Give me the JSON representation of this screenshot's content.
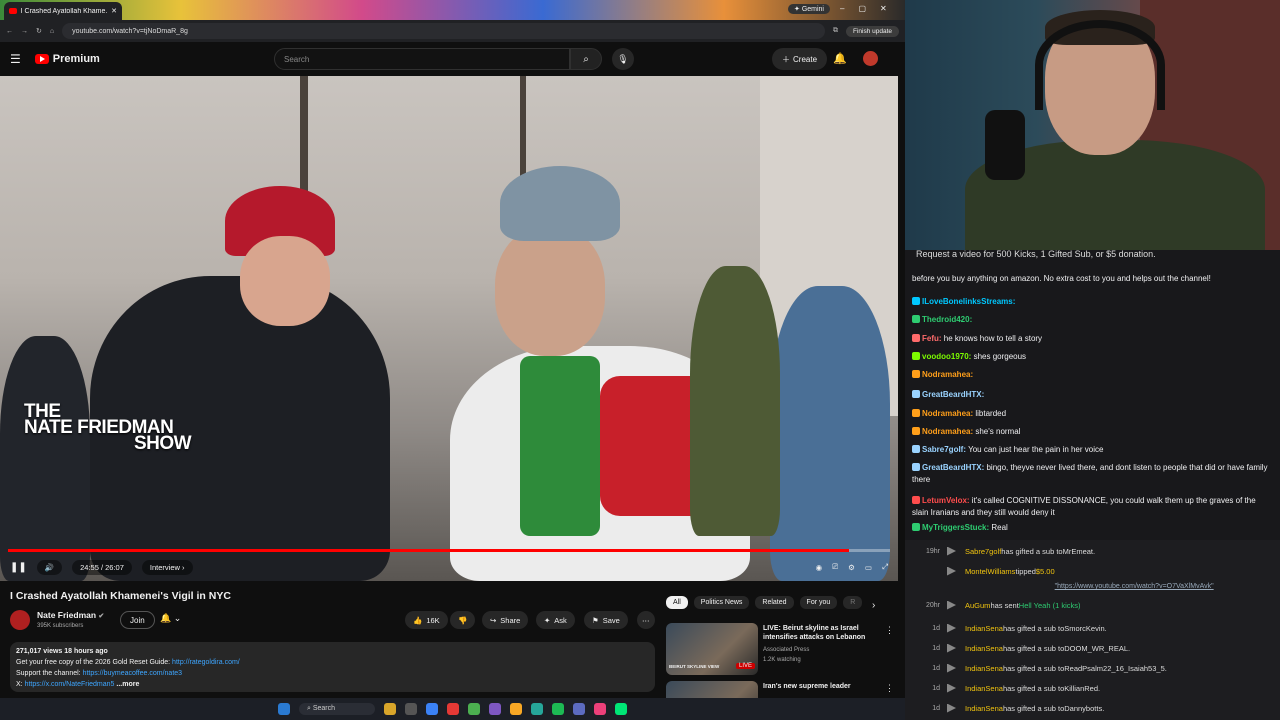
{
  "browser": {
    "tab_title": "I Crashed Ayatollah Khame...",
    "url": "youtube.com/watch?v=tjNoDmaR_8g",
    "gemini_label": "Gemini",
    "finish_update": "Finish update"
  },
  "youtube": {
    "logo_text": "Premium",
    "search_placeholder": "Search",
    "create_label": "Create",
    "video": {
      "overlay_title_1": "THE",
      "overlay_title_2": "NATE FRIEDMAN",
      "overlay_title_3": "SHOW",
      "time": "24:55 / 26:07",
      "chapter": "Interview",
      "progress": 0.954,
      "title": "I Crashed Ayatollah Khamenei's Vigil in NYC"
    },
    "channel": {
      "name": "Nate Friedman",
      "subs": "395K subscribers",
      "join": "Join"
    },
    "actions": {
      "likes": "16K",
      "share": "Share",
      "ask": "Ask",
      "save": "Save"
    },
    "description": {
      "stats": "271,017 views  18 hours ago",
      "line1_text": "Get your free copy of the 2026 Gold Reset Guide: ",
      "line1_link": "http://rategoldira.com/",
      "line2_text": "Support the channel: ",
      "line2_link": "https://buymeacoffee.com/nate3",
      "line3_text": "X: ",
      "line3_link": "https://x.com/NateFriedman5",
      "more": "...more"
    },
    "chips": [
      "All",
      "Politics News",
      "Related",
      "For you",
      "R"
    ],
    "recs": [
      {
        "title": "LIVE: Beirut skyline as Israel intensifies attacks on Lebanon",
        "channel": "Associated Press",
        "meta": "1.2K watching",
        "badge": "LIVE",
        "thumb_label": "BEIRUT SKYLINE VIEW"
      },
      {
        "title": "Iran's new supreme leader",
        "channel": "",
        "meta": "",
        "badge": "",
        "thumb_label": ""
      }
    ]
  },
  "chat": {
    "pinned": "Request a video for 500 Kicks, 1 Gifted Sub, or $5 donation.",
    "amazon": "before you buy anything on amazon. No extra cost to you and helps out the channel!",
    "messages": [
      {
        "user": "ILoveBonelinksStreams:",
        "color": "#00c8ff",
        "text": ""
      },
      {
        "user": "Thedroid420:",
        "color": "#2ecc71",
        "text": ""
      },
      {
        "user": "Fefu:",
        "color": "#ff6b6b",
        "text": "he knows how to tell a story"
      },
      {
        "user": "voodoo1970:",
        "color": "#7cfc00",
        "text": "shes gorgeous"
      },
      {
        "user": "Nodramahea:",
        "color": "#ff9f1a",
        "text": ""
      },
      {
        "user": "GreatBeardHTX:",
        "color": "#9ad3ff",
        "text": ""
      },
      {
        "user": "Nodramahea:",
        "color": "#ff9f1a",
        "text": "libtarded"
      },
      {
        "user": "Nodramahea:",
        "color": "#ff9f1a",
        "text": "she's normal"
      },
      {
        "user": "Sabre7golf:",
        "color": "#9ad3ff",
        "text": "You can just hear the pain in her voice"
      },
      {
        "user": "GreatBeardHTX:",
        "color": "#9ad3ff",
        "text": "bingo, theyve never lived there, and dont listen to people that did or have family there"
      },
      {
        "user": "LetumVelox:",
        "color": "#ff4d4d",
        "text": "it's called COGNITIVE DISSONANCE, you could walk them up the graves of the slain Iranians and they still would deny it"
      },
      {
        "user": "MyTriggersStuck:",
        "color": "#2ecc71",
        "text": "Real"
      }
    ]
  },
  "events": [
    {
      "time": "19hr",
      "name": "Sabre7golf",
      "text": " has gifted a sub to ",
      "target": "MrEmeat."
    },
    {
      "time": "",
      "name": "MontelWilliams",
      "text": " tipped ",
      "target": "$5.00",
      "link": "\"https://www.youtube.com/watch?v=O7VaXlMvAvk\""
    },
    {
      "time": "20hr",
      "name": "AuGum",
      "text": " has sent ",
      "target": "Hell Yeah (1 kicks)"
    },
    {
      "time": "1d",
      "name": "IndianSena",
      "text": " has gifted a sub to ",
      "target": "SmorcKevin."
    },
    {
      "time": "1d",
      "name": "IndianSena",
      "text": " has gifted a sub to ",
      "target": "DOOM_WR_REAL."
    },
    {
      "time": "1d",
      "name": "IndianSena",
      "text": " has gifted a sub to ",
      "target": "ReadPsalm22_16_Isaiah53_5."
    },
    {
      "time": "1d",
      "name": "IndianSena",
      "text": " has gifted a sub to ",
      "target": "KillianRed."
    },
    {
      "time": "1d",
      "name": "IndianSena",
      "text": " has gifted a sub to ",
      "target": "Dannybotts."
    }
  ],
  "taskbar": {
    "search": "Search"
  }
}
